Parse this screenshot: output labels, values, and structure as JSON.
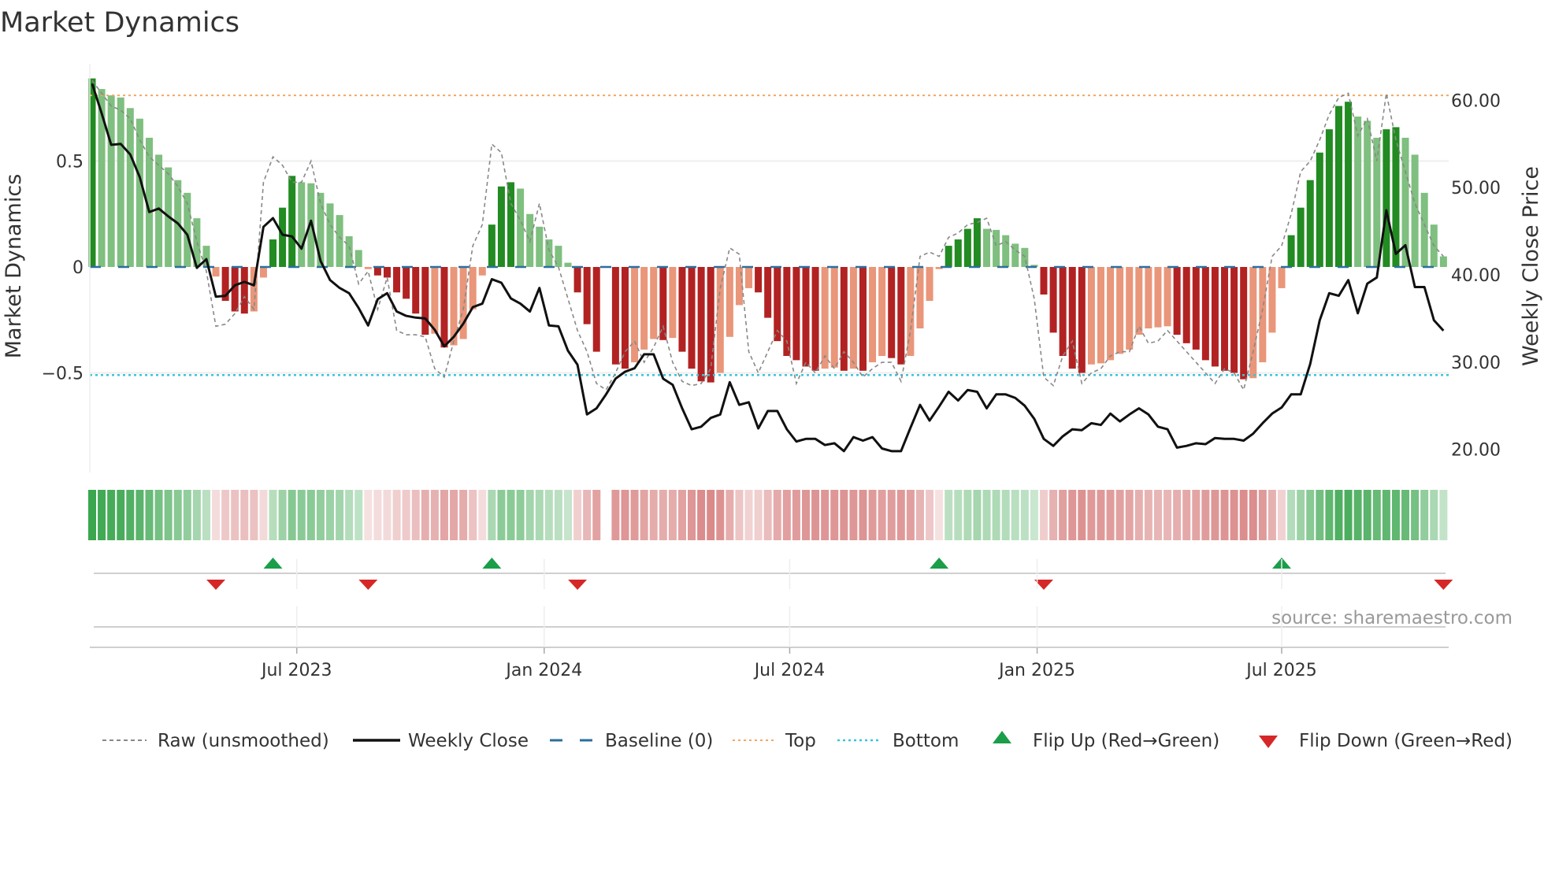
{
  "title": "Market Dynamics",
  "source": "source: sharemaestro.com",
  "chart_data": {
    "type": "bar",
    "title": "Market Dynamics",
    "ylabel_left": "Market Dynamics",
    "ylabel_right": "Weekly Close Price",
    "frequency": "weekly",
    "start_week": "2023-02-01",
    "baseline": 0,
    "top": 0.81,
    "bottom": -0.51,
    "ylim_left": [
      -0.96,
      0.96
    ],
    "ylim_right": [
      14.4,
      61.7
    ],
    "grid": true,
    "left_ticks": [
      {
        "value": 0.5,
        "label": "0.5"
      },
      {
        "value": 0,
        "label": "0"
      },
      {
        "value": -0.5,
        "label": "−0.5"
      }
    ],
    "right_ticks": [
      {
        "value": 60,
        "label": "60.00"
      },
      {
        "value": 50,
        "label": "50.00"
      },
      {
        "value": 40,
        "label": "40.00"
      },
      {
        "value": 30,
        "label": "30.00"
      },
      {
        "value": 20,
        "label": "20.00"
      }
    ],
    "x_ticks": [
      {
        "week": 21.5,
        "label": "Jul 2023"
      },
      {
        "week": 47.5,
        "label": "Jan 2024"
      },
      {
        "week": 73.3,
        "label": "Jul 2024"
      },
      {
        "week": 99.3,
        "label": "Jan 2025"
      },
      {
        "week": 125.0,
        "label": "Jul 2025"
      }
    ],
    "momentum": [
      0.89,
      0.84,
      0.81,
      0.8,
      0.75,
      0.7,
      0.61,
      0.53,
      0.47,
      0.41,
      0.35,
      0.23,
      0.1,
      -0.045,
      -0.16,
      -0.21,
      -0.22,
      -0.21,
      -0.05,
      0.13,
      0.28,
      0.43,
      0.4,
      0.395,
      0.35,
      0.3,
      0.245,
      0.145,
      0.08,
      -0.01,
      -0.04,
      -0.05,
      -0.12,
      -0.15,
      -0.22,
      -0.32,
      -0.315,
      -0.38,
      -0.37,
      -0.34,
      -0.2,
      -0.04,
      0.2,
      0.38,
      0.4,
      0.37,
      0.25,
      0.19,
      0.13,
      0.1,
      0.02,
      -0.12,
      -0.27,
      -0.4,
      null,
      -0.46,
      -0.48,
      -0.45,
      -0.39,
      -0.34,
      -0.345,
      -0.335,
      -0.4,
      -0.48,
      -0.54,
      -0.545,
      -0.5,
      -0.33,
      -0.18,
      -0.1,
      -0.12,
      -0.24,
      -0.35,
      -0.42,
      -0.44,
      -0.47,
      -0.49,
      -0.48,
      -0.475,
      -0.49,
      -0.48,
      -0.49,
      -0.45,
      -0.42,
      -0.43,
      -0.46,
      -0.42,
      -0.29,
      -0.16,
      -0.01,
      0.1,
      0.13,
      0.18,
      0.23,
      0.18,
      0.175,
      0.15,
      0.11,
      0.09,
      0.01,
      -0.13,
      -0.31,
      -0.42,
      -0.48,
      -0.5,
      -0.46,
      -0.455,
      -0.44,
      -0.41,
      -0.39,
      -0.32,
      -0.29,
      -0.285,
      -0.28,
      -0.32,
      -0.36,
      -0.39,
      -0.44,
      -0.47,
      -0.49,
      -0.5,
      -0.53,
      -0.525,
      -0.45,
      -0.31,
      -0.1,
      0.15,
      0.28,
      0.41,
      0.54,
      0.65,
      0.76,
      0.78,
      0.71,
      0.69,
      0.61,
      0.65,
      0.66,
      0.61,
      0.53,
      0.35,
      0.2,
      0.05
    ],
    "raw": [
      0.88,
      0.82,
      0.76,
      0.74,
      0.7,
      0.6,
      0.52,
      0.48,
      0.44,
      0.38,
      0.3,
      0.12,
      -0.02,
      -0.28,
      -0.27,
      -0.22,
      -0.14,
      -0.2,
      0.4,
      0.52,
      0.48,
      0.4,
      0.4,
      0.5,
      0.3,
      0.2,
      0.14,
      0.1,
      -0.08,
      -0.02,
      -0.2,
      -0.05,
      -0.3,
      -0.32,
      -0.32,
      -0.33,
      -0.48,
      -0.52,
      -0.35,
      -0.2,
      0.1,
      0.2,
      0.58,
      0.54,
      0.3,
      0.22,
      0.12,
      0.3,
      0.08,
      0.0,
      -0.15,
      -0.3,
      -0.4,
      -0.55,
      -0.58,
      -0.5,
      -0.4,
      -0.35,
      -0.45,
      -0.38,
      -0.28,
      -0.45,
      -0.54,
      -0.56,
      -0.55,
      -0.48,
      -0.1,
      0.09,
      0.06,
      -0.4,
      -0.5,
      -0.4,
      -0.3,
      -0.35,
      -0.55,
      -0.45,
      -0.5,
      -0.42,
      -0.48,
      -0.4,
      -0.45,
      -0.52,
      -0.48,
      -0.45,
      -0.45,
      -0.54,
      -0.3,
      0.05,
      0.07,
      0.05,
      0.14,
      0.16,
      0.2,
      0.21,
      0.23,
      0.1,
      0.12,
      0.08,
      0.05,
      -0.15,
      -0.52,
      -0.56,
      -0.42,
      -0.35,
      -0.55,
      -0.5,
      -0.48,
      -0.42,
      -0.4,
      -0.4,
      -0.28,
      -0.36,
      -0.35,
      -0.3,
      -0.35,
      -0.4,
      -0.45,
      -0.5,
      -0.55,
      -0.48,
      -0.5,
      -0.58,
      -0.4,
      -0.2,
      0.05,
      0.1,
      0.25,
      0.45,
      0.5,
      0.6,
      0.72,
      0.8,
      0.82,
      0.62,
      0.7,
      0.5,
      0.82,
      0.6,
      0.45,
      0.3,
      0.2,
      0.1,
      0.05
    ],
    "weekly_close": [
      61.9,
      58.5,
      54.9,
      55.0,
      53.8,
      51.2,
      47.2,
      47.6,
      46.7,
      45.9,
      44.6,
      40.8,
      41.8,
      37.5,
      37.6,
      38.8,
      39.2,
      38.8,
      45.5,
      46.5,
      44.6,
      44.4,
      43.0,
      46.2,
      41.6,
      39.4,
      38.5,
      37.9,
      36.2,
      34.2,
      37.2,
      37.9,
      35.8,
      35.3,
      35.1,
      35.0,
      33.7,
      31.8,
      32.9,
      34.4,
      36.3,
      36.7,
      39.5,
      39.1,
      37.3,
      36.7,
      35.8,
      38.5,
      34.2,
      34.1,
      31.3,
      29.7,
      24.0,
      24.7,
      26.3,
      28.1,
      28.9,
      29.3,
      30.9,
      30.9,
      28.1,
      27.4,
      24.7,
      22.3,
      22.6,
      23.6,
      24.0,
      27.7,
      25.1,
      25.4,
      22.4,
      24.4,
      24.4,
      22.3,
      20.9,
      21.2,
      21.2,
      20.5,
      20.7,
      19.8,
      21.4,
      21.0,
      21.4,
      20.1,
      19.8,
      19.8,
      22.5,
      25.1,
      23.3,
      24.9,
      26.6,
      25.6,
      26.8,
      26.6,
      24.7,
      26.3,
      26.3,
      25.9,
      25.0,
      23.5,
      21.2,
      20.4,
      21.5,
      22.3,
      22.2,
      23.0,
      22.8,
      24.1,
      23.2,
      24.0,
      24.7,
      24.0,
      22.6,
      22.3,
      20.2,
      20.4,
      20.7,
      20.6,
      21.3,
      21.2,
      21.2,
      21.0,
      21.8,
      23.0,
      24.1,
      24.8,
      26.3,
      26.3,
      29.8,
      34.8,
      37.9,
      37.6,
      39.4,
      35.6,
      39.0,
      39.7,
      47.4,
      42.4,
      43.4,
      38.6,
      38.6,
      34.8,
      33.6
    ],
    "flip_up_weeks": [
      19,
      42,
      89,
      125
    ],
    "flip_down_weeks": [
      13,
      29,
      51,
      100,
      142
    ],
    "legend_position": "bottom",
    "legend": [
      {
        "key": "raw",
        "label": "Raw (unsmoothed)"
      },
      {
        "key": "close",
        "label": "Weekly Close"
      },
      {
        "key": "baseline",
        "label": "Baseline (0)"
      },
      {
        "key": "top",
        "label": "Top"
      },
      {
        "key": "bottom",
        "label": "Bottom"
      },
      {
        "key": "flip_up",
        "label": "Flip Up (Red→Green)"
      },
      {
        "key": "flip_down",
        "label": "Flip Down (Green→Red)"
      }
    ],
    "colors": {
      "green_strong": "#228b22",
      "green_weak": "#7fbf7f",
      "red_strong": "#b22222",
      "red_weak": "#e9967a",
      "raw": "#888888",
      "close": "#111111",
      "baseline": "#2b6f9e",
      "top": "#f0a860",
      "bottom": "#3cc4d8",
      "flip_up": "#1a9e4a",
      "flip_down": "#d62728"
    }
  }
}
